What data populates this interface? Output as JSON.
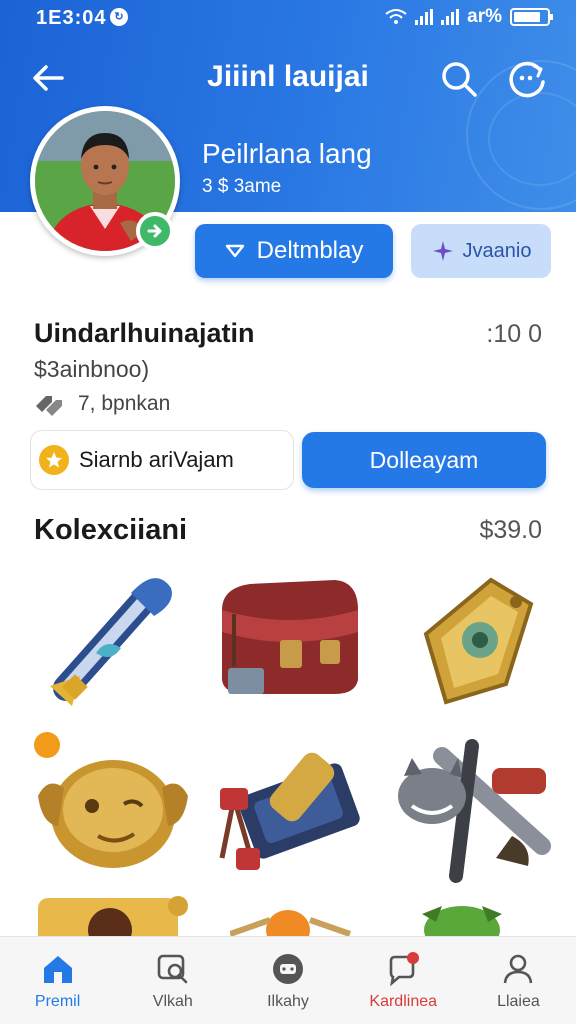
{
  "status": {
    "time": "1E3:04",
    "battery_text": "ar%"
  },
  "header": {
    "title": "Jiiinl lauijai"
  },
  "profile": {
    "name": "Peilrlana lang",
    "subtitle": "3 $ 3ame",
    "primary_button": "Deltmblay",
    "secondary_button": "Jvaanio"
  },
  "info": {
    "title": "Uindarlhuinajatin",
    "value": ":10 0",
    "price": "$3ainbnoo)",
    "meta": "7, bpnkan"
  },
  "actions": {
    "chip_label": "Siarnb ariVajam",
    "follow_button": "Dolleayam"
  },
  "collection": {
    "title": "Kolexciiani",
    "total": "$39.0",
    "items": [
      "scroll-icon",
      "satchel-icon",
      "shield-icon",
      "mask-icon",
      "cannon-icon",
      "beast-icon",
      "frame-icon",
      "fox-icon",
      "goblin-icon"
    ]
  },
  "nav": [
    {
      "label": "Premil",
      "icon": "home-icon",
      "state": "active"
    },
    {
      "label": "Vlkah",
      "icon": "search-card-icon",
      "state": "normal"
    },
    {
      "label": "Ilkahy",
      "icon": "chat-icon",
      "state": "normal"
    },
    {
      "label": "Kardlinea",
      "icon": "notification-icon",
      "state": "alert"
    },
    {
      "label": "Llaiea",
      "icon": "profile-icon",
      "state": "normal"
    }
  ],
  "colors": {
    "primary": "#2579e6",
    "header": "#1c63d6",
    "alert": "#d93a3a",
    "badge": "#3fb86a"
  }
}
